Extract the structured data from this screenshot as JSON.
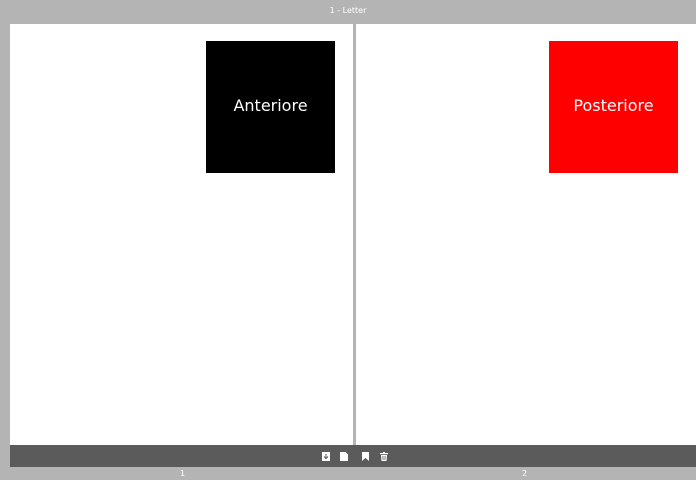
{
  "spread": {
    "title": "1 - Letter"
  },
  "pages": [
    {
      "number": "1",
      "block_label": "Anteriore",
      "block_color": "#000000"
    },
    {
      "number": "2",
      "block_label": "Posteriore",
      "block_color": "#ff0000"
    }
  ],
  "toolbar": {
    "icons": [
      "download-icon",
      "page-icon",
      "bookmark-icon",
      "trash-icon"
    ]
  }
}
